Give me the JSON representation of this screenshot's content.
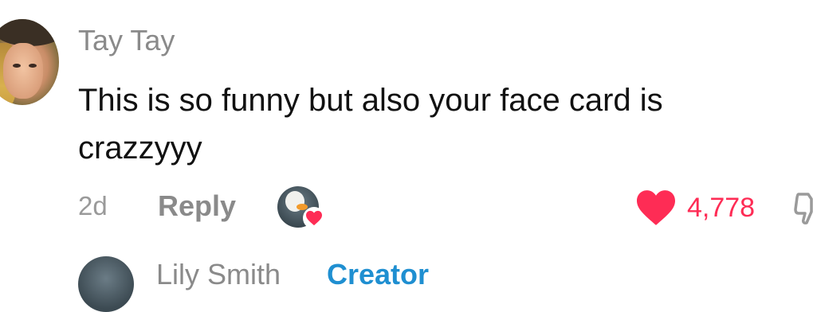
{
  "comment": {
    "username": "Tay Tay",
    "text": "This is so funny but also your face card is crazzyyy",
    "time": "2d",
    "reply_label": "Reply",
    "like_count": "4,778"
  },
  "next_comment": {
    "username": "Lily Smith",
    "badge": "Creator"
  },
  "colors": {
    "like_red": "#fe2c55",
    "muted_gray": "#8a8a8a",
    "creator_blue": "#1f8fd1"
  },
  "icons": {
    "like": "heart-icon",
    "creator_liked": "creator-liked-icon",
    "dislike": "thumbs-down-icon"
  }
}
